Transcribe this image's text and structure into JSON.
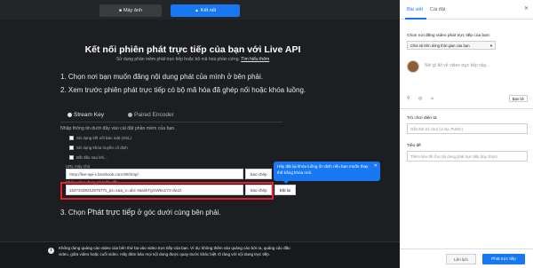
{
  "topbar": {
    "camera_tab": "Máy ảnh",
    "connect_tab": "Kết nối"
  },
  "main": {
    "title": "Kết nối phiên phát trực tiếp của bạn với Live API",
    "subtitle": "Sử dụng phần mềm phát trực tiếp hoặc bộ mã hoá phần cứng.",
    "subtitle_link": "Tìm hiểu thêm",
    "step1": "1. Chọn nơi bạn muốn đăng nội dung phát của mình ở bên phải.",
    "step2": "2. Xem trước phiên phát trực tiếp có bộ mã hóa đã ghép nối hoặc khóa luồng.",
    "step3_prefix": "3. Chọn ",
    "step3_emph": "Phát trực tiếp",
    "step3_suffix": " ở góc dưới cùng bên phải.",
    "stream_key_tab": "Stream Key",
    "paired_encoder_tab": "Paired Encoder",
    "settings_note": "Nhập thông tin dưới đây vào cài đặt phần mềm của bạn.",
    "checkboxes": [
      "Sử dụng kết nối bảo mật (SSL)",
      "Sử dụng khóa truyền cố định",
      "Bắt đầu sau khi..."
    ],
    "url_label": "URL máy chủ",
    "url_value": "rtmp://live-api-s.facebook.com:80/rtmp/",
    "key_label": "Khóa video đang phát lần đầu",
    "key_value": "1547343821257577s_ps=1&a_v=abc-s6ankTgr4Wku1Y2-dwJz",
    "copy_label": "Sao chép",
    "reset_label": "Đặt lại",
    "tooltip": "Hãy đặt lại khóa luồng ổn định nếu bạn muốn thay thế bằng khóa mới."
  },
  "footer": {
    "notice": "Không dùng quảng cáo video của bên thứ ba vào video trực tiếp của bạn. Ví dụ: không thêm vào quảng cáo bởi ra, quảng cáo đầu video, giữa video hoặc cuối video. Hãy đảm bảo mọi nội dung được quay trước khác biệt rõ ràng với nội dung trực tiếp."
  },
  "panel": {
    "tab_post": "Bài viết",
    "tab_settings": "Cài đặt",
    "choose_label": "Chọn nơi đăng video phát trực tiếp của bạn:",
    "choose_value": "Chia sẻ trên dòng thời gian của bạn",
    "placeholder": "Nói gì đó về video trực tiếp này...",
    "audience": "Bạn bè",
    "game_label": "Trò chơi điện tử",
    "game_placeholder": "Gắn thẻ trò chơi (ví dụ: PUBG)",
    "title_label": "Tiêu đề",
    "title_placeholder": "Thêm tiêu đề cho nội dung phát trực tiếp (tùy chọn)",
    "back_label": "Lên lịch",
    "golive_label": "Phát trực tiếp"
  },
  "colors": {
    "accent": "#1877f2",
    "highlight": "#e3202b",
    "dark_bg": "#1c1e21"
  }
}
